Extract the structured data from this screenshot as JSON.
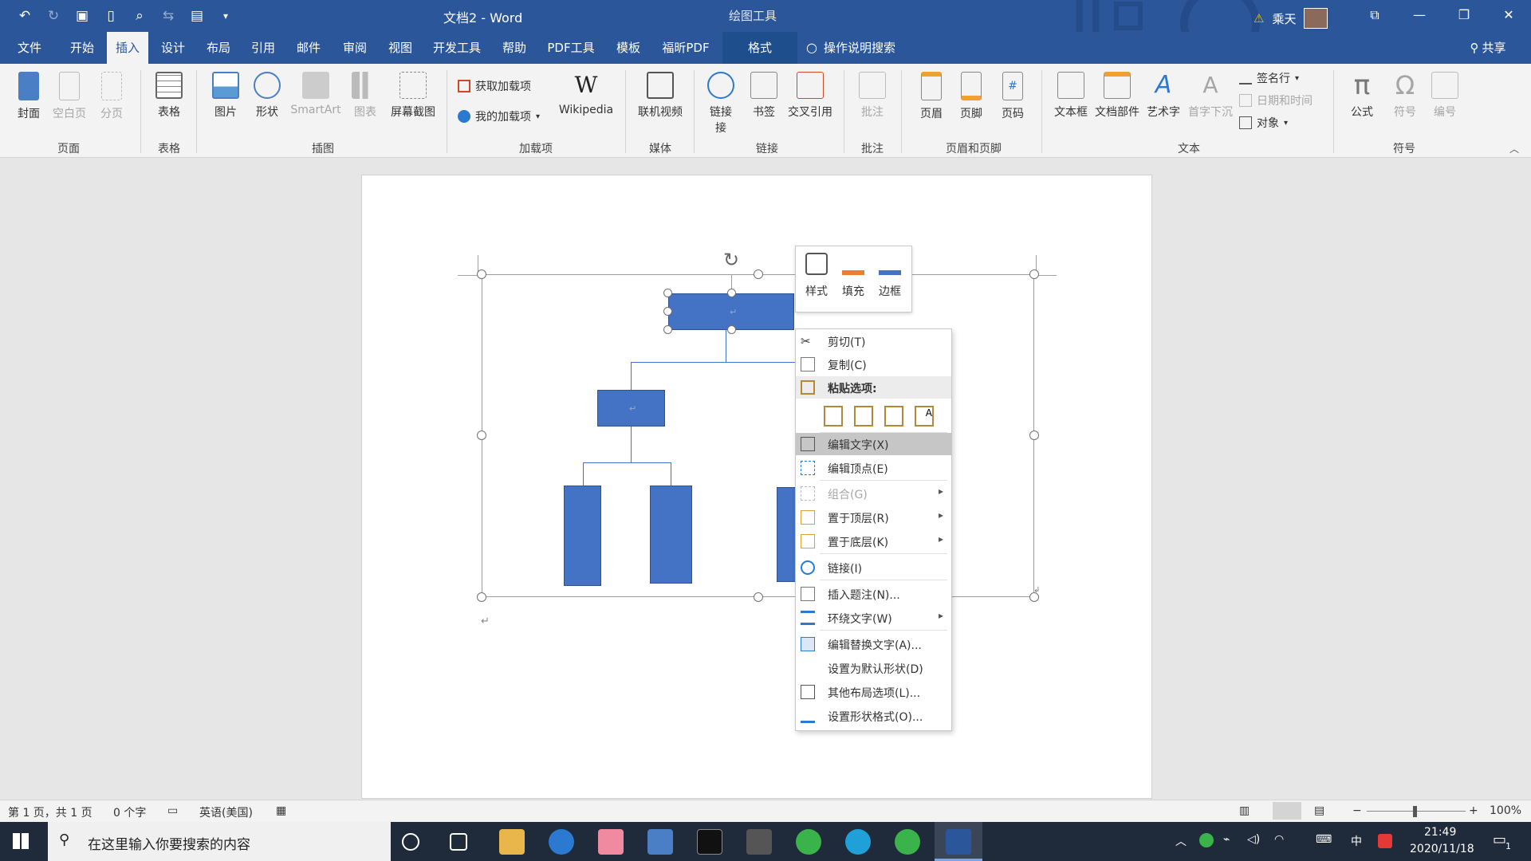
{
  "title": {
    "doc": "文档2 - Word",
    "context_tool": "绘图工具",
    "user": "乘天"
  },
  "tabs": [
    "文件",
    "开始",
    "插入",
    "设计",
    "布局",
    "引用",
    "邮件",
    "审阅",
    "视图",
    "开发工具",
    "帮助",
    "PDF工具",
    "模板",
    "福昕PDF",
    "格式"
  ],
  "tell_me": "操作说明搜索",
  "share": "共享",
  "ribbon": {
    "cover": "封面",
    "blank": "空白页",
    "break": "分页",
    "table": "表格",
    "picture": "图片",
    "shapes": "形状",
    "smartart": "SmartArt",
    "chart": "图表",
    "screenshot": "屏幕截图",
    "get_addins": "获取加载项",
    "my_addins": "我的加载项",
    "wikipedia": "Wikipedia",
    "online_video": "联机视频",
    "link": "链接",
    "link2": "接",
    "bookmark": "书签",
    "crossref": "交叉引用",
    "comment": "批注",
    "header": "页眉",
    "footer": "页脚",
    "pagenum": "页码",
    "textbox": "文本框",
    "quickparts": "文档部件",
    "wordart": "艺术字",
    "dropcap": "首字下沉",
    "signature": "签名行",
    "datetime": "日期和时间",
    "object": "对象",
    "equation": "公式",
    "symbol": "符号",
    "number": "编号",
    "groups": {
      "pages": "页面",
      "tables": "表格",
      "illustrations": "插图",
      "addins": "加载项",
      "media": "媒体",
      "links": "链接",
      "comments": "批注",
      "headerfooter": "页眉和页脚",
      "text": "文本",
      "symbols": "符号"
    }
  },
  "minitoolbar": {
    "style": "样式",
    "fill": "填充",
    "outline": "边框"
  },
  "context_menu": {
    "cut": "剪切(T)",
    "copy": "复制(C)",
    "paste_options": "粘贴选项:",
    "edit_text": "编辑文字(X)",
    "edit_points": "编辑顶点(E)",
    "group": "组合(G)",
    "bring_front": "置于顶层(R)",
    "send_back": "置于底层(K)",
    "link": "链接(I)",
    "caption": "插入题注(N)...",
    "wrap": "环绕文字(W)",
    "alt_text": "编辑替换文字(A)...",
    "default_shape": "设置为默认形状(D)",
    "more_layout": "其他布局选项(L)...",
    "format_shape": "设置形状格式(O)..."
  },
  "status": {
    "page": "第 1 页，共 1 页",
    "words": "0 个字",
    "lang": "英语(美国)",
    "zoom": "100%"
  },
  "taskbar": {
    "search_placeholder": "在这里输入你要搜索的内容",
    "ime": "中",
    "time": "21:49",
    "date": "2020/11/18",
    "notify_count": "1"
  },
  "colors": {
    "title_bg": "#2b579a",
    "shape_fill": "#4472c4",
    "fill_accent": "#ed7d31"
  }
}
